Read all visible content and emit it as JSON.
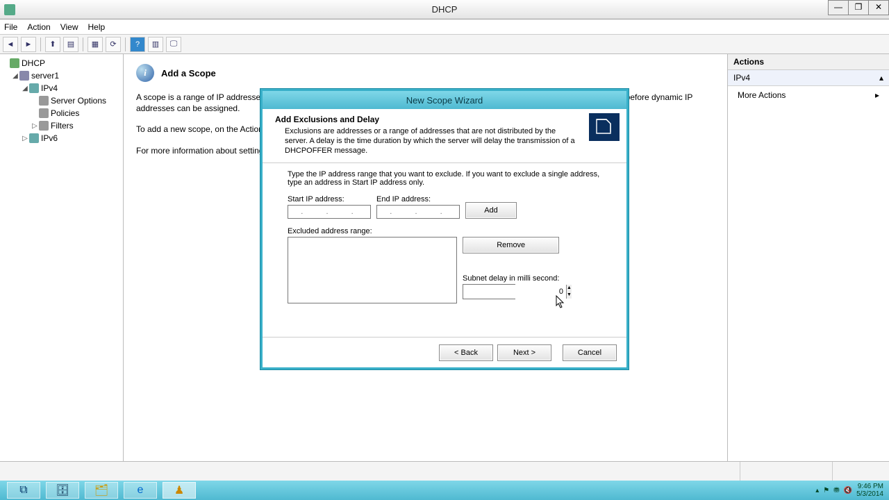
{
  "window": {
    "title": "DHCP",
    "menus": {
      "file": "File",
      "action": "Action",
      "view": "View",
      "help": "Help"
    },
    "controls": {
      "min": "—",
      "max": "❐",
      "close": "✕"
    }
  },
  "tree": {
    "root": "DHCP",
    "server": "server1",
    "ipv4": "IPv4",
    "ipv4_children": {
      "server_options": "Server Options",
      "policies": "Policies",
      "filters": "Filters"
    },
    "ipv6": "IPv6"
  },
  "center": {
    "heading": "Add a Scope",
    "p1": "A scope is a range of IP addresses assigned to computers requesting a dynamic IP address. You must create and configure a scope before dynamic IP addresses can be assigned.",
    "p2": "To add a new scope, on the Action menu, click New Scope.",
    "p3": "For more information about setting up a DHCP server, see online Help."
  },
  "actions": {
    "header": "Actions",
    "node": "IPv4",
    "more": "More Actions",
    "arrow": "▸",
    "collapse": "▴"
  },
  "wizard": {
    "title": "New Scope Wizard",
    "section": "Add Exclusions and Delay",
    "section_desc": "Exclusions are addresses or a range of addresses that are not distributed by the server. A delay is the time duration by which the server will delay the transmission of a DHCPOFFER message.",
    "instr": "Type the IP address range that you want to exclude. If you want to exclude a single address, type an address in Start IP address only.",
    "start_label": "Start IP address:",
    "end_label": "End IP address:",
    "add": "Add",
    "excluded_label": "Excluded address range:",
    "remove": "Remove",
    "delay_label": "Subnet delay in milli second:",
    "delay_value": "0",
    "ip_placeholder": ".   .   .",
    "back": "< Back",
    "next": "Next >",
    "cancel": "Cancel"
  },
  "taskbar": {
    "time": "9:46 PM",
    "date": "5/3/2014"
  }
}
